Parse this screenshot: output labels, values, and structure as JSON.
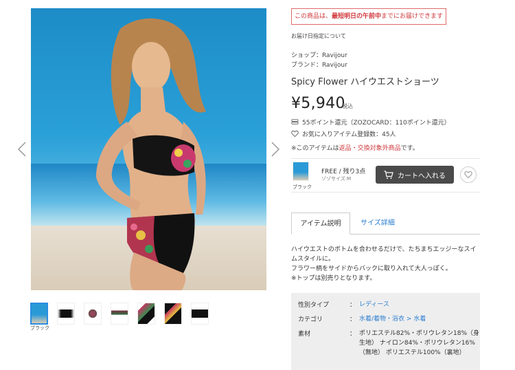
{
  "image": {
    "alt": "model wearing black bikini with floral print high-waist shorts"
  },
  "thumbnails": {
    "selected_label": "ブラック"
  },
  "notice": {
    "prefix": "この商品は、",
    "bold": "最短明日の午前中",
    "suffix": "までにお届けできます"
  },
  "delivery_link": "お届け日指定について",
  "shop_line": "ショップ：Ravijour",
  "brand_line": "ブランド：Ravijour",
  "product": {
    "name": "Spicy Flower ハイウエストショーツ",
    "price": "¥5,940",
    "tax_label": "税込"
  },
  "points_line": "55ポイント還元（ZOZOCARD：110ポイント還元）",
  "favorites_line": "お気に入りアイテム登録数：45人",
  "note": {
    "prefix": "※このアイテムは",
    "red": "返品・交換対象外商品",
    "suffix": "です。"
  },
  "sku": {
    "color": "ブラック",
    "size_stock": "FREE / 残り3点",
    "size_note": "ゾゾサイズ:M",
    "cart_label": "カートへ入れる"
  },
  "tabs": {
    "active": "アイテム説明",
    "other": "サイズ詳細"
  },
  "description": [
    "ハイウエストのボトムを合わせるだけで、たちまちエッジーなスイムスタイルに。",
    "フラワー柄をサイドからバックに取り入れて大人っぽく。",
    "※トップは別売りとなります。"
  ],
  "spec": {
    "gender_key": "性別タイプ",
    "gender_val": "レディース",
    "category_key": "カテゴリ",
    "category_val1": "水着/着物・浴衣",
    "category_sep": ">",
    "category_val2": "水着",
    "material_key": "素材",
    "material_val": "ポリエステル82%・ポリウレタン18%（身生地） ナイロン84%・ポリウレタン16%（無地） ポリエステル100%（裏地）",
    "colon": "："
  },
  "colors": {
    "accent_blue": "#2a7dd1",
    "alert_red": "#d0363a",
    "cart_bg": "#4a4a4a"
  }
}
